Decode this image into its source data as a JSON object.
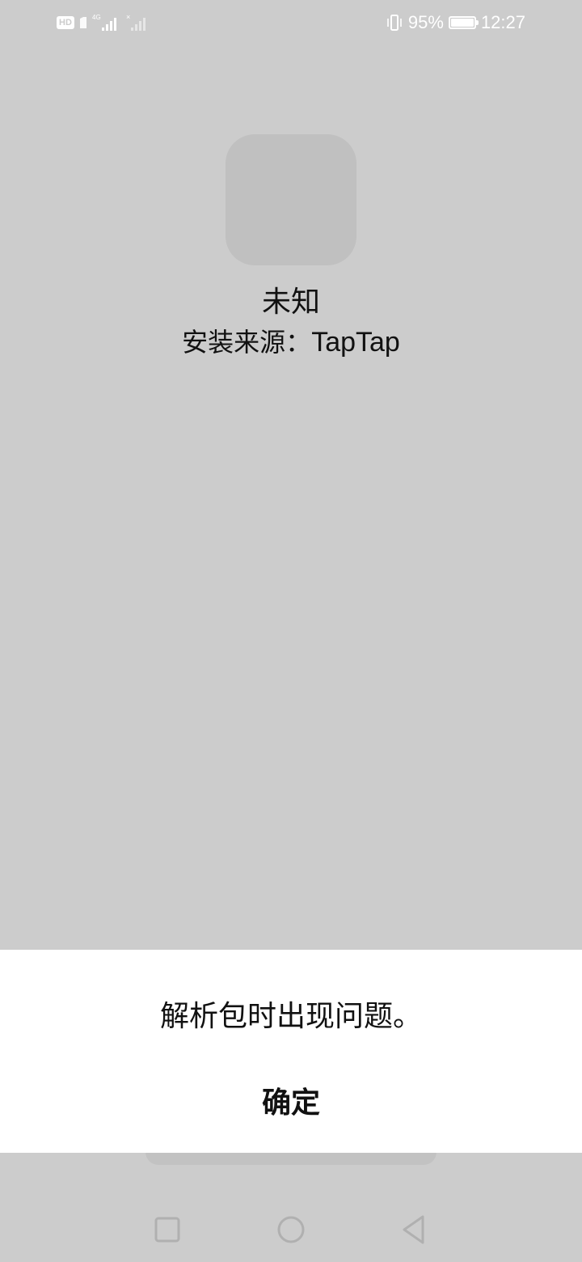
{
  "status_bar": {
    "hd_label": "HD",
    "network_label": "4G",
    "battery_percent": "95%",
    "battery_level": 0.95,
    "time": "12:27"
  },
  "app": {
    "name": "未知",
    "install_source_label": "安装来源：",
    "install_source_value": "TapTap"
  },
  "dialog": {
    "message": "解析包时出现问题。",
    "confirm_label": "确定"
  },
  "nav_bar": {
    "recent_icon": "square-icon",
    "home_icon": "circle-icon",
    "back_icon": "triangle-back-icon"
  },
  "colors": {
    "background": "#cccccc",
    "dialog_background": "#ffffff",
    "icon_placeholder": "#c0c0c0",
    "text": "#111111"
  }
}
